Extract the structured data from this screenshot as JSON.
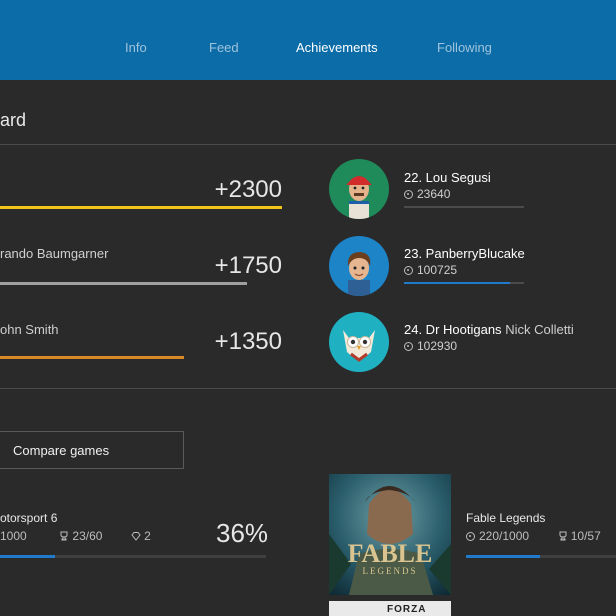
{
  "header": {
    "tabs": [
      {
        "label": "Info"
      },
      {
        "label": "Feed"
      },
      {
        "label": "Achievements"
      },
      {
        "label": "Following"
      }
    ]
  },
  "leaderboard": {
    "title": "ard",
    "rows": [
      {
        "name": "",
        "score": "+2300",
        "bar_color": "#f2c618",
        "bar_fraction": 1.0
      },
      {
        "name": "rando Baumgarner",
        "score": "+1750",
        "bar_color": "#a0a0a0",
        "bar_fraction": 0.88
      },
      {
        "name": "ohn Smith",
        "score": "+1350",
        "bar_color": "#d98a26",
        "bar_fraction": 0.65
      }
    ]
  },
  "ranking": [
    {
      "name": "22. Lou Segusi",
      "sub": "",
      "gamerscore": "23640",
      "fill": 0.0,
      "avatar_icon": "red-cap-avatar-icon"
    },
    {
      "name": "23. PanberryBlucake",
      "sub": "",
      "gamerscore": "100725",
      "fill": 0.88,
      "avatar_icon": "brown-hair-avatar-icon"
    },
    {
      "name": "24. Dr Hootigans",
      "sub": "Nick Colletti",
      "gamerscore": "102930",
      "fill": 0.0,
      "avatar_icon": "owl-avatar-icon"
    }
  ],
  "compare": {
    "label": "Compare games"
  },
  "games": [
    {
      "title": "otorsport 6",
      "gamerscore": "1000",
      "achievements": "23/60",
      "gems": "2",
      "percent": "36%",
      "progress": 0.36
    },
    {
      "title": "Fable Legends",
      "gamerscore": "220/1000",
      "achievements": "10/57",
      "progress": 0.22,
      "cover_title": "FABLE",
      "cover_sub": "LEGENDS"
    }
  ],
  "next_game": {
    "cover_text": "FORZA"
  },
  "colors": {
    "header": "#0b6ca8",
    "accent": "#1f7acb",
    "background": "#2a2a2a"
  }
}
